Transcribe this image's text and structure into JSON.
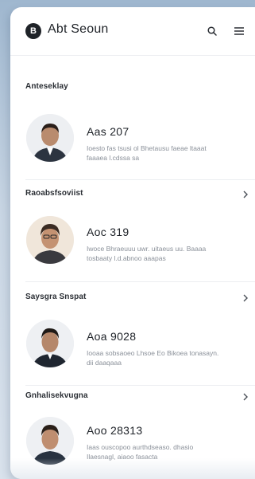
{
  "header": {
    "logo_letter": "B",
    "title": "Abt Seoun",
    "search_icon": "search-icon",
    "menu_icon": "hamburger-menu-icon"
  },
  "sections": [
    {
      "label": "Anteseklay",
      "has_chevron": false,
      "profile": {
        "name": "Aas 207",
        "description": "Ioesto fas tsusi ol Bhetausu faeae ltaaat faaaea l.cdssa sa"
      }
    },
    {
      "label": "Raoabsfsoviist",
      "has_chevron": true,
      "profile": {
        "name": "Aoc 319",
        "description": "Iwoce Bhraeuuu uwr. uitaeus uu. Baaaa tosbaaty l.d.abnoo aaapas"
      }
    },
    {
      "label": "Saysgra Snspat",
      "has_chevron": true,
      "profile": {
        "name": "Aoa 9028",
        "description": "Iooaa sobsaoeo Lhsoe Eo Bikoea tonasayn. dii daaqaaa"
      }
    },
    {
      "label": "Gnhalisekvugna",
      "has_chevron": true,
      "profile": {
        "name": "Aoo 28313",
        "description": "Iaas ouscopoo aurthdseaso. dhasio Ilaesnagl, aiaoo fasacta"
      }
    }
  ],
  "colors": {
    "accent_dark": "#1f2328",
    "text_secondary": "#8a9099",
    "background": "#9fb7cf"
  }
}
